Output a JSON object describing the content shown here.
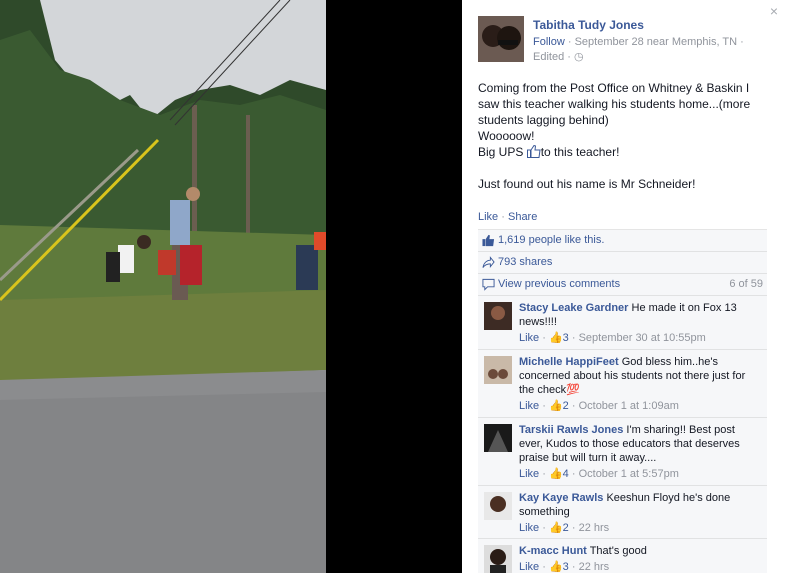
{
  "photo": {
    "alt": ""
  },
  "close_glyph": "×",
  "post": {
    "author": "Tabitha Tudy Jones",
    "follow": "Follow",
    "date_location": "September 28 near Memphis, TN",
    "edited": "Edited",
    "text_line1": "Coming from the Post Office on Whitney & Baskin I saw this teacher walking his students home...(more students lagging behind)",
    "text_line2": "Wooooow!",
    "text_line3a": "Big UPS",
    "text_line3b": "to this teacher!",
    "text_line4": "Just found out his name is Mr Schneider!"
  },
  "actions": {
    "like": "Like",
    "share": "Share"
  },
  "ufi": {
    "likes": "1,619 people like this.",
    "shares": "793 shares",
    "view_previous": "View previous comments",
    "pager": "6 of 59"
  },
  "comments": [
    {
      "name": "Stacy Leake Gardner",
      "text": "He made it on Fox 13 news!!!!",
      "like": "Like",
      "count": "3",
      "time": "September 30 at 10:55pm"
    },
    {
      "name": "Michelle HappiFeet",
      "text": "God bless him..he's concerned about his students not there just for the check💯",
      "like": "Like",
      "count": "2",
      "time": "October 1 at 1:09am"
    },
    {
      "name": "Tarskii Rawls Jones",
      "text": "I'm sharing!! Best post ever, Kudos to those educators that deserves praise but will turn it away....",
      "like": "Like",
      "count": "4",
      "time": "October 1 at 5:57pm"
    },
    {
      "name": "Kay Kaye Rawls",
      "text": "Keeshun Floyd he's done something",
      "like": "Like",
      "count": "2",
      "time": "22 hrs"
    },
    {
      "name": "K-macc Hunt",
      "text": "That's good",
      "like": "Like",
      "count": "3",
      "time": "22 hrs"
    }
  ],
  "colors": {
    "link": "#3b5998",
    "muted": "#90949c",
    "panel": "#f6f7f9"
  },
  "icons": {
    "like": "thumbs-up-icon",
    "share": "share-arrow-icon",
    "comment": "comment-bubble-icon",
    "globe": "globe-icon",
    "close": "close-icon"
  }
}
